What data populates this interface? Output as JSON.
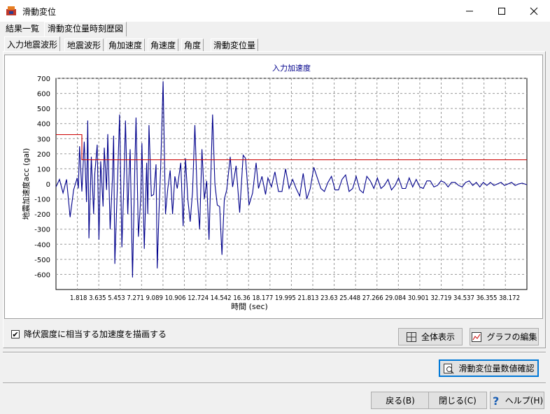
{
  "window": {
    "title": "滑動変位"
  },
  "top_tabs": [
    "結果一覧",
    "滑動変位量時刻歴図"
  ],
  "sub_tabs": [
    "入力地震波形",
    "地震波形",
    "角加速度",
    "角速度",
    "角度",
    "滑動変位量"
  ],
  "chart_data": {
    "type": "line",
    "title": "入力加速度",
    "xlabel": "時間 (sec)",
    "ylabel": "地震加速度acc (gal)",
    "ylim": [
      -700,
      700
    ],
    "xlim": [
      0,
      40
    ],
    "yticks": [
      "700",
      "600",
      "500",
      "400",
      "300",
      "200",
      "100",
      "0",
      "-100",
      "-200",
      "-300",
      "-400",
      "-500",
      "-600"
    ],
    "xticks": [
      "1.818",
      "3.635",
      "5.453",
      "7.271",
      "9.089",
      "10.906",
      "12.724",
      "14.542",
      "16.36",
      "18.177",
      "19.995",
      "21.813",
      "23.63",
      "25.448",
      "27.266",
      "29.084",
      "30.901",
      "32.719",
      "34.537",
      "36.355",
      "38.172"
    ],
    "grid": true,
    "series": [
      {
        "color": "#00008b",
        "values": [
          [
            0.0,
            -20
          ],
          [
            0.3,
            30
          ],
          [
            0.6,
            -60
          ],
          [
            0.9,
            30
          ],
          [
            1.2,
            -220
          ],
          [
            1.5,
            -40
          ],
          [
            1.8,
            40
          ],
          [
            1.9,
            -30
          ],
          [
            2.0,
            250
          ],
          [
            2.2,
            -50
          ],
          [
            2.4,
            280
          ],
          [
            2.6,
            -120
          ],
          [
            2.7,
            420
          ],
          [
            2.8,
            -360
          ],
          [
            3.0,
            180
          ],
          [
            3.2,
            -200
          ],
          [
            3.3,
            70
          ],
          [
            3.5,
            260
          ],
          [
            3.65,
            -370
          ],
          [
            3.8,
            150
          ],
          [
            4.0,
            -150
          ],
          [
            4.1,
            240
          ],
          [
            4.3,
            -40
          ],
          [
            4.4,
            330
          ],
          [
            4.6,
            -300
          ],
          [
            4.8,
            50
          ],
          [
            4.9,
            320
          ],
          [
            5.0,
            -530
          ],
          [
            5.2,
            -50
          ],
          [
            5.4,
            460
          ],
          [
            5.6,
            -420
          ],
          [
            5.8,
            100
          ],
          [
            5.9,
            420
          ],
          [
            6.1,
            -200
          ],
          [
            6.2,
            40
          ],
          [
            6.3,
            230
          ],
          [
            6.5,
            -620
          ],
          [
            6.7,
            120
          ],
          [
            6.8,
            440
          ],
          [
            7.0,
            -350
          ],
          [
            7.2,
            -100
          ],
          [
            7.3,
            270
          ],
          [
            7.5,
            -430
          ],
          [
            7.7,
            140
          ],
          [
            7.8,
            -200
          ],
          [
            7.9,
            390
          ],
          [
            8.1,
            -80
          ],
          [
            8.3,
            -70
          ],
          [
            8.5,
            130
          ],
          [
            8.6,
            -560
          ],
          [
            8.75,
            -190
          ],
          [
            8.9,
            120
          ],
          [
            9.1,
            680
          ],
          [
            9.3,
            -200
          ],
          [
            9.5,
            -30
          ],
          [
            9.7,
            90
          ],
          [
            9.9,
            -200
          ],
          [
            10.1,
            50
          ],
          [
            10.3,
            -30
          ],
          [
            10.6,
            140
          ],
          [
            10.8,
            -280
          ],
          [
            11.0,
            170
          ],
          [
            11.2,
            -100
          ],
          [
            11.4,
            -250
          ],
          [
            11.6,
            -50
          ],
          [
            11.8,
            390
          ],
          [
            12.0,
            -80
          ],
          [
            12.2,
            -300
          ],
          [
            12.4,
            230
          ],
          [
            12.6,
            -100
          ],
          [
            12.8,
            20
          ],
          [
            13.0,
            -370
          ],
          [
            13.3,
            460
          ],
          [
            13.5,
            0
          ],
          [
            13.7,
            -140
          ],
          [
            13.9,
            -150
          ],
          [
            14.1,
            -470
          ],
          [
            14.3,
            -100
          ],
          [
            14.5,
            -40
          ],
          [
            14.8,
            180
          ],
          [
            15.0,
            -20
          ],
          [
            15.3,
            120
          ],
          [
            15.6,
            -190
          ],
          [
            15.9,
            190
          ],
          [
            16.1,
            170
          ],
          [
            16.4,
            -140
          ],
          [
            16.7,
            -60
          ],
          [
            17.0,
            140
          ],
          [
            17.2,
            -30
          ],
          [
            17.5,
            50
          ],
          [
            17.8,
            -70
          ],
          [
            18.0,
            40
          ],
          [
            18.3,
            -20
          ],
          [
            18.6,
            80
          ],
          [
            18.9,
            -50
          ],
          [
            19.2,
            -50
          ],
          [
            19.5,
            100
          ],
          [
            19.8,
            -30
          ],
          [
            20.1,
            30
          ],
          [
            20.4,
            -30
          ],
          [
            20.7,
            -80
          ],
          [
            21.0,
            70
          ],
          [
            21.3,
            -100
          ],
          [
            21.6,
            -30
          ],
          [
            21.9,
            110
          ],
          [
            22.2,
            40
          ],
          [
            22.5,
            -30
          ],
          [
            22.8,
            -50
          ],
          [
            23.1,
            10
          ],
          [
            23.4,
            50
          ],
          [
            23.7,
            -40
          ],
          [
            24.0,
            -40
          ],
          [
            24.3,
            30
          ],
          [
            24.6,
            60
          ],
          [
            24.9,
            -50
          ],
          [
            25.2,
            -30
          ],
          [
            25.5,
            50
          ],
          [
            25.8,
            -40
          ],
          [
            26.1,
            -60
          ],
          [
            26.4,
            50
          ],
          [
            26.7,
            20
          ],
          [
            27.0,
            -30
          ],
          [
            27.3,
            40
          ],
          [
            27.6,
            -30
          ],
          [
            27.9,
            -10
          ],
          [
            28.2,
            30
          ],
          [
            28.5,
            -40
          ],
          [
            28.8,
            -10
          ],
          [
            29.1,
            40
          ],
          [
            29.4,
            -30
          ],
          [
            29.7,
            -30
          ],
          [
            30.0,
            40
          ],
          [
            30.3,
            -20
          ],
          [
            30.6,
            30
          ],
          [
            30.9,
            -20
          ],
          [
            31.2,
            -30
          ],
          [
            31.5,
            20
          ],
          [
            31.8,
            20
          ],
          [
            32.1,
            -20
          ],
          [
            32.4,
            -10
          ],
          [
            32.7,
            20
          ],
          [
            33.0,
            10
          ],
          [
            33.3,
            -20
          ],
          [
            33.6,
            10
          ],
          [
            33.9,
            10
          ],
          [
            34.2,
            -10
          ],
          [
            34.5,
            -20
          ],
          [
            34.8,
            10
          ],
          [
            35.1,
            20
          ],
          [
            35.4,
            -10
          ],
          [
            35.7,
            10
          ],
          [
            36.0,
            -20
          ],
          [
            36.3,
            10
          ],
          [
            36.6,
            -10
          ],
          [
            36.9,
            10
          ],
          [
            37.2,
            -10
          ],
          [
            37.5,
            0
          ],
          [
            37.8,
            10
          ],
          [
            38.1,
            -10
          ],
          [
            38.4,
            0
          ],
          [
            38.7,
            10
          ],
          [
            39.0,
            -10
          ],
          [
            39.3,
            0
          ],
          [
            39.6,
            5
          ],
          [
            40.0,
            -5
          ]
        ]
      },
      {
        "color": "#cc0000",
        "values": [
          [
            0.0,
            327
          ],
          [
            2.2,
            327
          ],
          [
            2.2,
            160
          ],
          [
            40.0,
            160
          ]
        ]
      }
    ]
  },
  "checkbox": {
    "label": "降伏震度に相当する加速度を描画する",
    "checked": true
  },
  "buttons": {
    "show_all": "全体表示",
    "edit_graph": "グラフの編集",
    "confirm": "滑動変位量数値確認",
    "back": "戻る(B)",
    "close": "閉じる(C)",
    "help": "ヘルプ(H)"
  }
}
